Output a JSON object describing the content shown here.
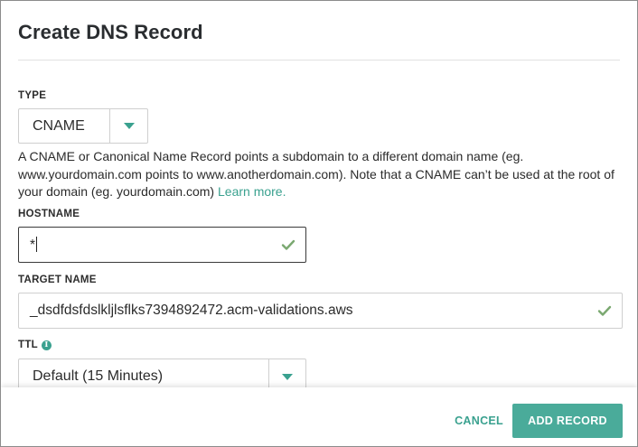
{
  "dialog": {
    "title": "Create DNS Record"
  },
  "type_field": {
    "label": "TYPE",
    "value": "CNAME",
    "description": "A CNAME or Canonical Name Record points a subdomain to a different domain name (eg. www.yourdomain.com points to www.anotherdomain.com). Note that a CNAME can’t be used at the root of your domain (eg. yourdomain.com)",
    "learn_more": "Learn more."
  },
  "hostname_field": {
    "label": "HOSTNAME",
    "value": "*"
  },
  "target_field": {
    "label": "TARGET NAME",
    "value": "_dsdfdsfdslkljlsflks7394892472.acm-validations.aws"
  },
  "ttl_field": {
    "label": "TTL",
    "info_icon_text": "i",
    "value": "Default (15 Minutes)"
  },
  "footer": {
    "cancel_label": "CANCEL",
    "add_label": "ADD RECORD"
  },
  "colors": {
    "accent": "#3aa18f",
    "primary_button": "#4aab9a"
  },
  "icons": {
    "dropdown": "chevron-down-icon",
    "valid": "check-icon",
    "info": "info-icon"
  }
}
